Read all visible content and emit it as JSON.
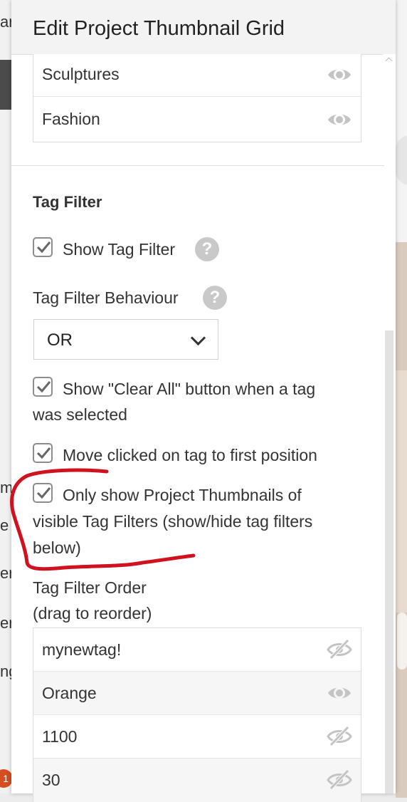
{
  "background": {
    "left_texts": [
      "ar",
      "m",
      "e",
      "er",
      "er",
      "ng"
    ],
    "badge": "1"
  },
  "panel": {
    "title": "Edit Project Thumbnail Grid",
    "categories": [
      {
        "label": "Sculptures",
        "icon": "eye-icon"
      },
      {
        "label": "Fashion",
        "icon": "eye-icon"
      }
    ]
  },
  "tag_filter": {
    "section_title": "Tag Filter",
    "show_tag_filter": {
      "label": "Show Tag Filter",
      "checked": true
    },
    "help_glyph": "?",
    "behaviour_label": "Tag Filter Behaviour",
    "behaviour_value": "OR",
    "clear_all_line1": "Show \"Clear All\" button when a tag",
    "clear_all_line2": "was selected",
    "move_clicked": "Move clicked on tag to first position",
    "only_show_line1": "Only show Project Thumbnails of",
    "only_show_line2": "visible Tag Filters (show/hide tag filters",
    "only_show_line3": "below)",
    "order_label_line1": "Tag Filter Order",
    "order_label_line2": "(drag to reorder)",
    "tags": [
      {
        "label": "mynewtag!",
        "icon": "eye-slash-icon"
      },
      {
        "label": "Orange",
        "icon": "eye-icon"
      },
      {
        "label": "1100",
        "icon": "eye-slash-icon"
      },
      {
        "label": "30",
        "icon": "eye-slash-icon"
      }
    ]
  },
  "colors": {
    "annotation": "#d0121f",
    "icon_gray": "#c4c4c4"
  }
}
